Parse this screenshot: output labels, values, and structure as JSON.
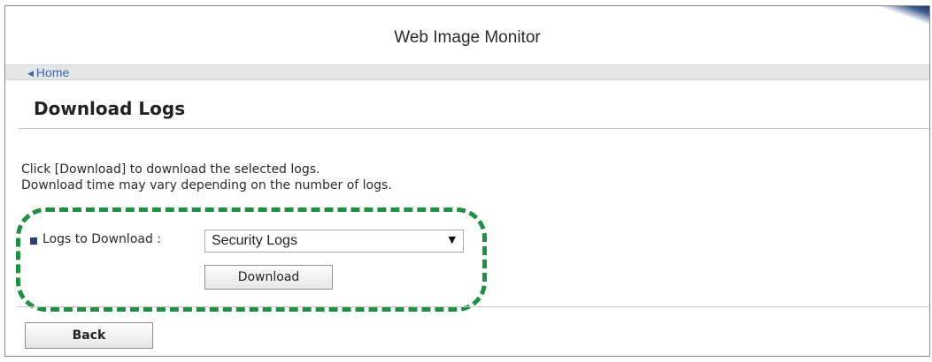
{
  "header": {
    "title": "Web Image Monitor"
  },
  "nav": {
    "home_label": "Home"
  },
  "page": {
    "title": "Download Logs"
  },
  "description": {
    "line1": "Click [Download] to download the selected logs.",
    "line2": "Download time may vary depending on the number of logs."
  },
  "form": {
    "logs_label": "Logs to Download :",
    "selected_log": "Security Logs",
    "download_label": "Download"
  },
  "footer": {
    "back_label": "Back"
  },
  "icons": {
    "home": "chevron-left-icon",
    "bullet": "square-bullet-icon",
    "dropdown": "caret-down-icon"
  },
  "colors": {
    "highlight_outline": "#1f8f42",
    "link": "#3b68a8",
    "bullet": "#2c3f78",
    "nav_bar": "#e6e6e6"
  }
}
